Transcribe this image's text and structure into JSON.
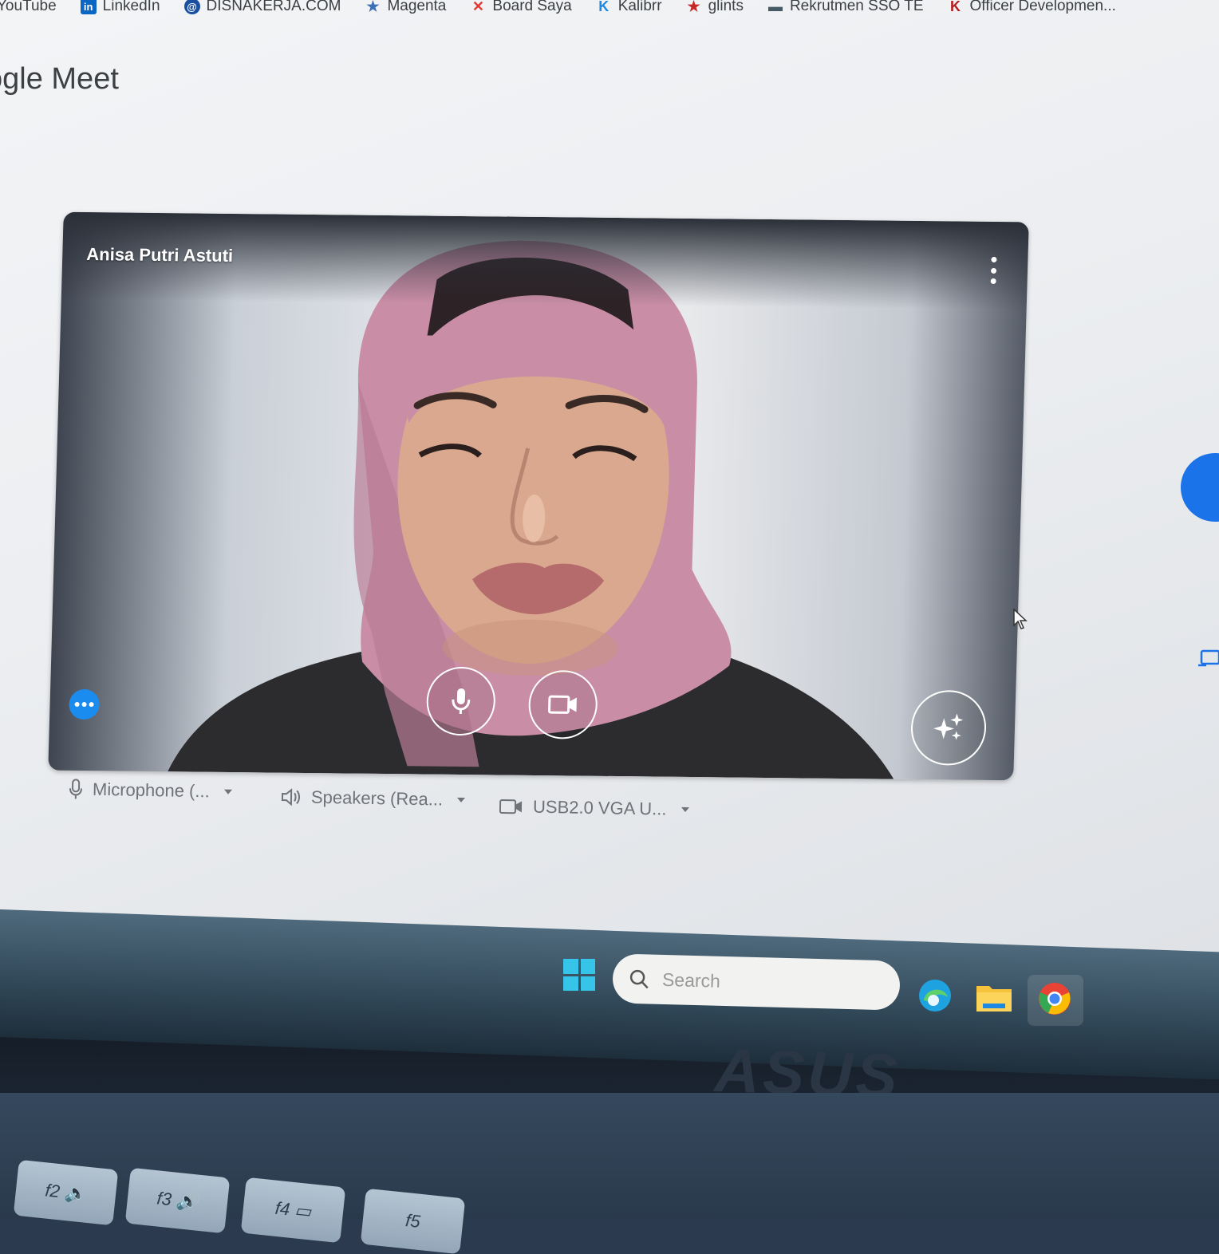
{
  "bookmarks": [
    {
      "label": "YouTube",
      "icon": "youtube-icon",
      "color": "#ff0000"
    },
    {
      "label": "LinkedIn",
      "icon": "linkedin-icon",
      "color": "#0a66c2"
    },
    {
      "label": "DISNAKERJA.COM",
      "icon": "disnakerja-icon",
      "color": "#1a4fa0"
    },
    {
      "label": "Magenta",
      "icon": "magenta-icon",
      "color": "#3d6fb5"
    },
    {
      "label": "Board Saya",
      "icon": "board-icon",
      "color": "#e53935"
    },
    {
      "label": "Kalibrr",
      "icon": "kalibrr-icon",
      "color": "#1e88e5"
    },
    {
      "label": "glints",
      "icon": "glints-icon",
      "color": "#c62828"
    },
    {
      "label": "Rekrutmen SSO TE",
      "icon": "rekrutmen-icon",
      "color": "#455a64"
    },
    {
      "label": "Officer Developmen...",
      "icon": "officer-icon",
      "color": "#b71c1c"
    }
  ],
  "app": {
    "title": "Google Meet",
    "visible_title": "ogle Meet"
  },
  "preview": {
    "participant_name": "Anisa Putri Astuti",
    "mic_button_icon": "microphone-icon",
    "camera_button_icon": "videocam-icon",
    "effects_button_icon": "sparkle-icon",
    "more_options_icon": "more-vert-icon"
  },
  "devices": {
    "microphone": "Microphone (...",
    "speakers": "Speakers (Rea...",
    "camera": "USB2.0 VGA U..."
  },
  "taskbar": {
    "search_placeholder": "Search",
    "apps": [
      "windows-start-icon",
      "edge-icon",
      "file-explorer-icon",
      "chrome-icon"
    ]
  },
  "hardware": {
    "brand": "ASUS",
    "keys": [
      "f2",
      "f3",
      "f4",
      "f5"
    ]
  },
  "colors": {
    "accent_blue": "#1a73e8",
    "dots_button": "#1a8cef",
    "hijab_pink": "#c98ea6"
  }
}
